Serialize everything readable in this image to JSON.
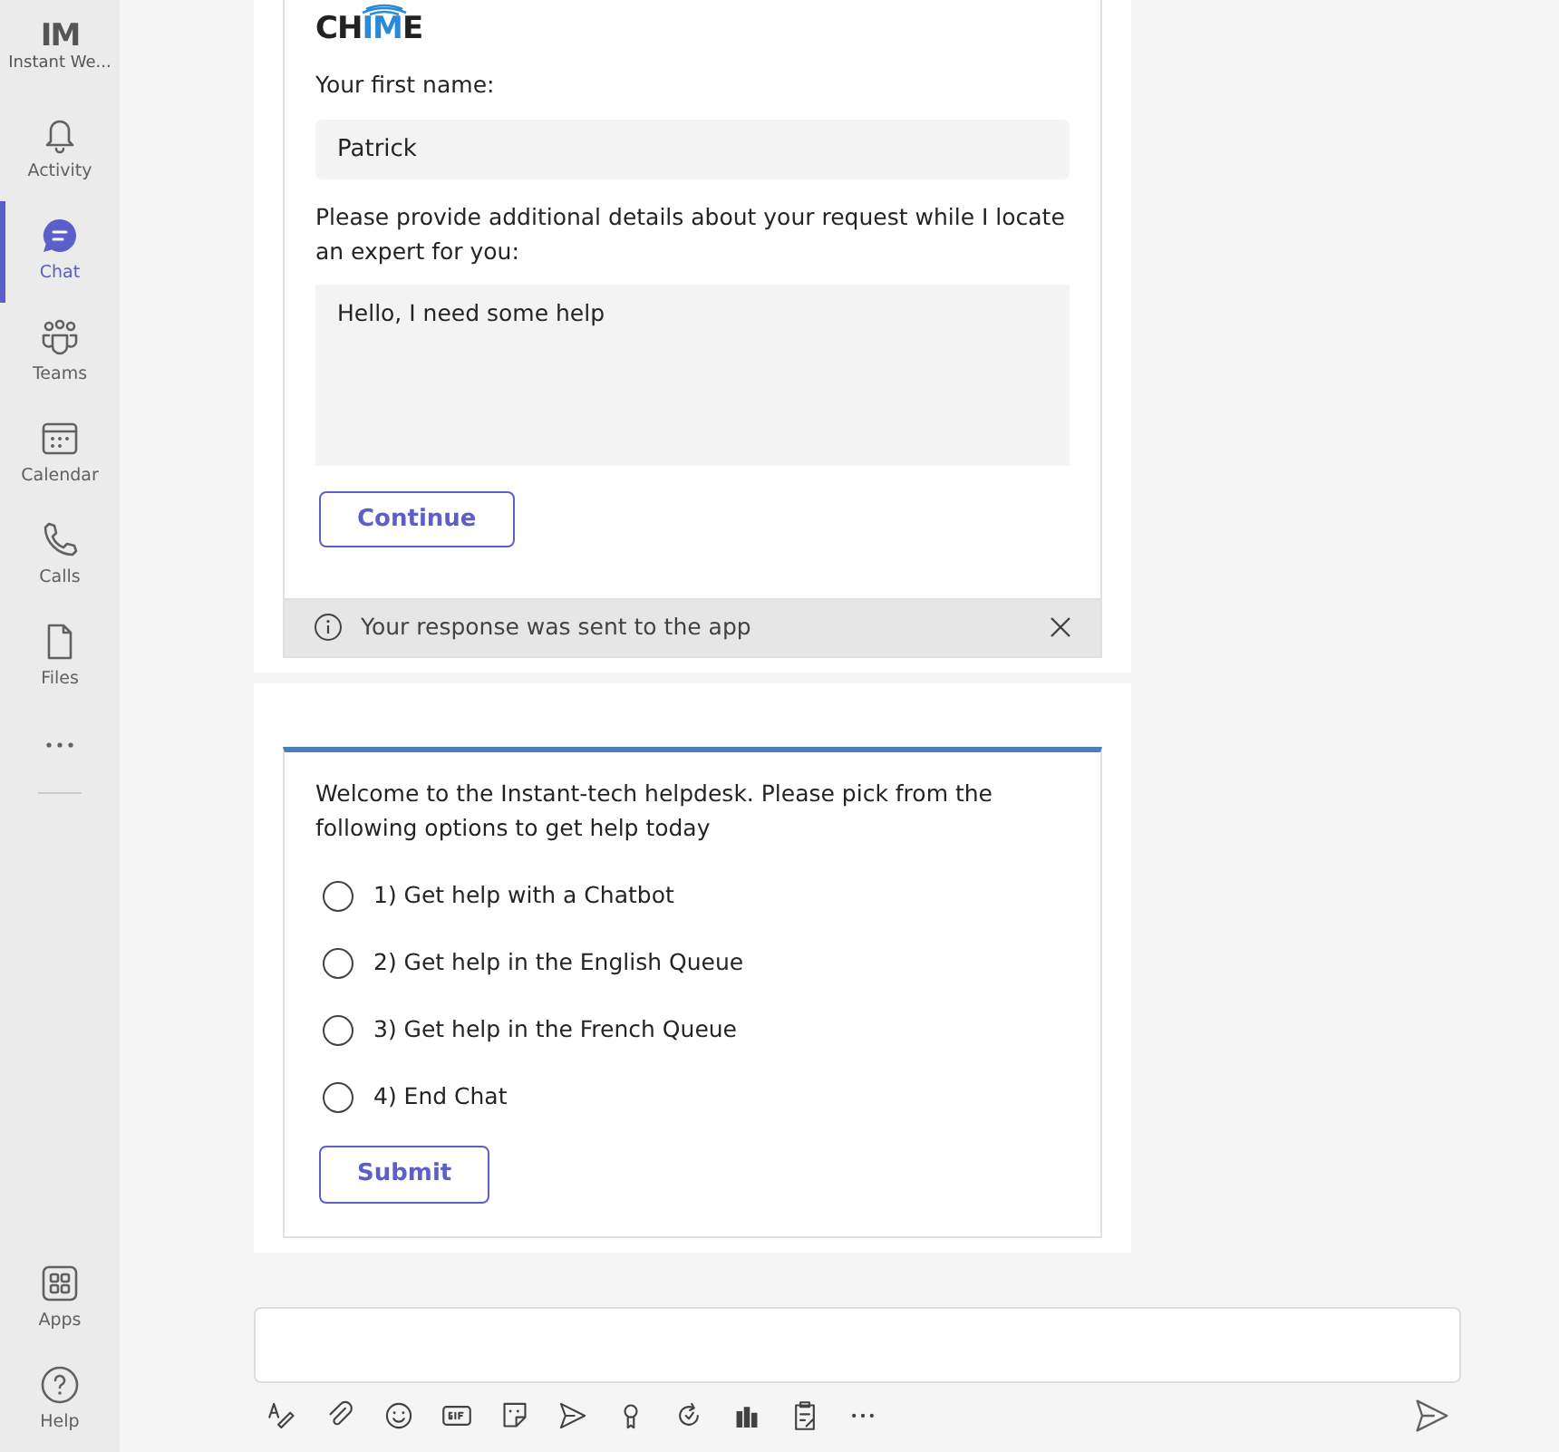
{
  "app": {
    "logo": "IM",
    "title": "Instant We..."
  },
  "sidebar": {
    "items": [
      {
        "label": "Activity",
        "selected": false
      },
      {
        "label": "Chat",
        "selected": true
      },
      {
        "label": "Teams",
        "selected": false
      },
      {
        "label": "Calendar",
        "selected": false
      },
      {
        "label": "Calls",
        "selected": false
      },
      {
        "label": "Files",
        "selected": false
      }
    ],
    "bottom_items": [
      {
        "label": "Apps",
        "selected": false
      },
      {
        "label": "Help",
        "selected": false
      }
    ]
  },
  "form_card": {
    "logo": [
      {
        "text": "CH",
        "accent": false
      },
      {
        "text": "IM",
        "accent": true
      },
      {
        "text": "E",
        "accent": false
      }
    ],
    "name_label": "Your first name:",
    "name_value": "Patrick",
    "details_label": "Please provide additional details about your request while I locate an expert for you:",
    "details_value": "Hello, I need some help",
    "button": "Continue",
    "notice": "Your response was sent to the app"
  },
  "menu_card": {
    "prompt": "Welcome to the Instant-tech helpdesk. Please pick from the following options to get help today",
    "options": [
      {
        "label": "1) Get help with a Chatbot",
        "selected": false
      },
      {
        "label": "2) Get help in the English Queue",
        "selected": false
      },
      {
        "label": "3) Get help in the French Queue",
        "selected": false
      },
      {
        "label": "4) End Chat",
        "selected": false
      }
    ],
    "button": "Submit"
  }
}
